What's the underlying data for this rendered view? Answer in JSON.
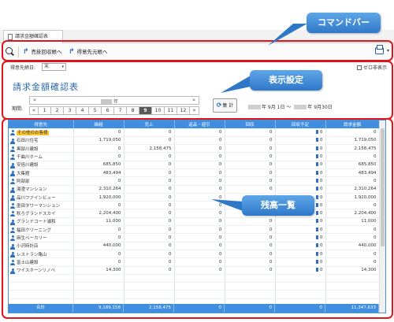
{
  "tab": {
    "label": "請求金額確認表"
  },
  "toolbar": {
    "btn_sales_transfer": "売掛回収帳へ",
    "btn_deadline_transfer": "得意先元帳へ"
  },
  "settings": {
    "deadline_label": "得意先締日:",
    "deadline_value": "末",
    "zero_display": "ゼロ非表示",
    "title": "請求金額確認表",
    "period_label": "期間:",
    "year_suffix": "年",
    "months": [
      "1",
      "2",
      "3",
      "4",
      "5",
      "6",
      "7",
      "8",
      "9",
      "10",
      "11",
      "12"
    ],
    "active_month": "9",
    "calc_button": "集 計",
    "range_start": "年 9月 1日 ～",
    "range_end": "年 9月30日"
  },
  "grid": {
    "columns": [
      "得意先",
      "繰越",
      "売上",
      "返品・値引",
      "回収",
      "回収予定",
      "請求金額"
    ],
    "rows": [
      {
        "name": "その他のお客様",
        "carry": "0",
        "sales": "0",
        "returns": "0",
        "collect": "0",
        "planned": "0",
        "billing": "0"
      },
      {
        "name": "石田川住宅",
        "carry": "1,719,050",
        "sales": "0",
        "returns": "0",
        "collect": "0",
        "planned": "0",
        "billing": "1,719,050"
      },
      {
        "name": "黒部川建設",
        "carry": "0",
        "sales": "2,158,475",
        "returns": "0",
        "collect": "0",
        "planned": "0",
        "billing": "2,158,475"
      },
      {
        "name": "千曲川ホーム",
        "carry": "0",
        "sales": "0",
        "returns": "0",
        "collect": "0",
        "planned": "0",
        "billing": "0"
      },
      {
        "name": "安倍川建設",
        "carry": "685,850",
        "sales": "0",
        "returns": "0",
        "collect": "0",
        "planned": "0",
        "billing": "685,850"
      },
      {
        "name": "大集館",
        "carry": "483,494",
        "sales": "0",
        "returns": "0",
        "collect": "0",
        "planned": "0",
        "billing": "483,494"
      },
      {
        "name": "阿部部",
        "carry": "0",
        "sales": "0",
        "returns": "0",
        "collect": "0",
        "planned": "0",
        "billing": "0"
      },
      {
        "name": "湯澄マンション",
        "carry": "2,310,264",
        "sales": "0",
        "returns": "0",
        "collect": "0",
        "planned": "0",
        "billing": "2,310,264"
      },
      {
        "name": "品川ファインビュー",
        "carry": "1,920,000",
        "sales": "0",
        "returns": "0",
        "collect": "0",
        "planned": "0",
        "billing": "1,920,000"
      },
      {
        "name": "墨田タワーマンション",
        "carry": "0",
        "sales": "0",
        "returns": "0",
        "collect": "0",
        "planned": "0",
        "billing": "0"
      },
      {
        "name": "秋ろグランドスカイ",
        "carry": "2,204,400",
        "sales": "0",
        "returns": "0",
        "collect": "0",
        "planned": "0",
        "billing": "2,204,400"
      },
      {
        "name": "グランドコート浦和",
        "carry": "11,000",
        "sales": "0",
        "returns": "0",
        "collect": "0",
        "planned": "0",
        "billing": "11,000"
      },
      {
        "name": "福田クリーニング",
        "carry": "0",
        "sales": "0",
        "returns": "0",
        "collect": "0",
        "planned": "0",
        "billing": "0"
      },
      {
        "name": "麻生ベーカリー",
        "carry": "0",
        "sales": "0",
        "returns": "0",
        "collect": "0",
        "planned": "0",
        "billing": "0"
      },
      {
        "name": "小沢時計店",
        "carry": "440,000",
        "sales": "0",
        "returns": "0",
        "collect": "0",
        "planned": "0",
        "billing": "440,000"
      },
      {
        "name": "レストラン亀山",
        "carry": "0",
        "sales": "0",
        "returns": "0",
        "collect": "0",
        "planned": "0",
        "billing": "0"
      },
      {
        "name": "富士山建設",
        "carry": "0",
        "sales": "0",
        "returns": "0",
        "collect": "0",
        "planned": "0",
        "billing": "0"
      },
      {
        "name": "ワイスホーンリノベ",
        "carry": "14,300",
        "sales": "0",
        "returns": "0",
        "collect": "0",
        "planned": "0",
        "billing": "14,300"
      }
    ],
    "totals": {
      "label": "合計",
      "carry": "9,189,158",
      "sales": "2,158,475",
      "returns": "0",
      "collect": "0",
      "planned": "0",
      "billing": "11,347,633"
    }
  },
  "callouts": {
    "command_bar": "コマンドバー",
    "display_settings": "表示設定",
    "balance_list": "残高一覧"
  },
  "colors": {
    "accent": "#3f8ee0",
    "highlight_box": "#e1141c",
    "callout": "#2f78c8",
    "selected": "#ffc72e"
  }
}
